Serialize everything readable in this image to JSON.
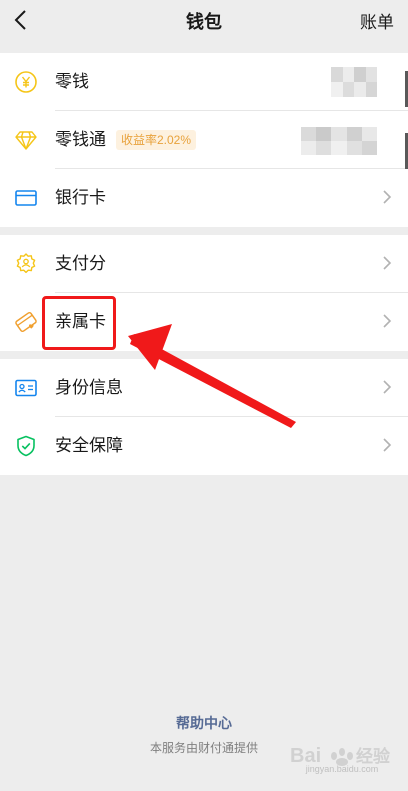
{
  "nav": {
    "title": "钱包",
    "right_label": "账单",
    "back_icon": "chevron-left-icon"
  },
  "group1": {
    "items": [
      {
        "label": "零钱",
        "icon": "yuan-coin-icon",
        "value_hidden": true
      },
      {
        "label": "零钱通",
        "icon": "diamond-icon",
        "badge": "收益率2.02%",
        "value_hidden": true
      },
      {
        "label": "银行卡",
        "icon": "bank-card-icon"
      }
    ]
  },
  "group2": {
    "items": [
      {
        "label": "支付分",
        "icon": "gear-shield-icon"
      },
      {
        "label": "亲属卡",
        "icon": "family-card-icon"
      }
    ]
  },
  "group3": {
    "items": [
      {
        "label": "身份信息",
        "icon": "id-card-icon"
      },
      {
        "label": "安全保障",
        "icon": "shield-check-icon"
      }
    ]
  },
  "footer": {
    "help_link": "帮助中心",
    "provider_note": "本服务由财付通提供"
  },
  "watermark": {
    "text": "jingyan.baidu.com"
  },
  "colors": {
    "accent_yellow": "#f5c518",
    "badge_text": "#e8a23c",
    "link_blue": "#576b95",
    "highlight_red": "#f0191a",
    "green": "#07c160"
  }
}
